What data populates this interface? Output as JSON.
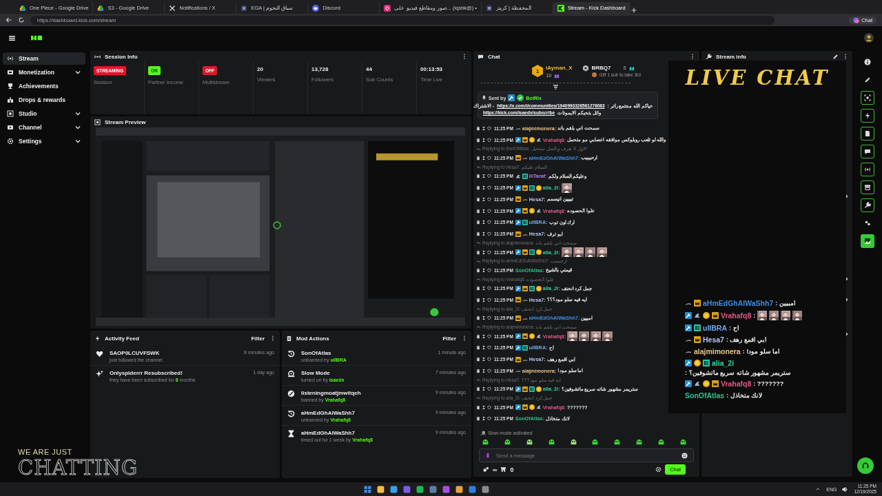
{
  "browser": {
    "tabs": [
      {
        "label": "One Piece - Google Drive",
        "kind": "drive",
        "selected": false
      },
      {
        "label": "S3 - Google Drive",
        "kind": "drive",
        "selected": false
      },
      {
        "label": "Notifications / X",
        "kind": "x",
        "selected": false
      },
      {
        "label": "EGA | سباق النجوم",
        "kind": "page",
        "selected": false
      },
      {
        "label": "Discord",
        "kind": "discord",
        "selected": false
      },
      {
        "label": "صور ومقاطع فيديو على... (iqsbk@) •",
        "kind": "camera",
        "selected": false
      },
      {
        "label": "المحفظة | كريتز",
        "kind": "page",
        "selected": false
      },
      {
        "label": "Stream - Kick Dashboard",
        "kind": "kick",
        "selected": true
      }
    ],
    "url": "https://dashboard.kick.com/stream",
    "chat_button": "Chat"
  },
  "sidebar": {
    "items": [
      {
        "label": "Stream",
        "kind": "stream",
        "selected": true,
        "expandable": false
      },
      {
        "label": "Monetization",
        "kind": "money",
        "selected": false,
        "expandable": true
      },
      {
        "label": "Achievements",
        "kind": "trophy",
        "selected": false,
        "expandable": false
      },
      {
        "label": "Drops & rewards",
        "kind": "gift",
        "selected": false,
        "expandable": false
      },
      {
        "label": "Studio",
        "kind": "studio",
        "selected": false,
        "expandable": true
      },
      {
        "label": "Channel",
        "kind": "channel",
        "selected": false,
        "expandable": true
      },
      {
        "label": "Settings",
        "kind": "gear",
        "selected": false,
        "expandable": true
      }
    ]
  },
  "overlay_art": {
    "tagline": "WE ARE JUST",
    "title": "CHATTING"
  },
  "session_info": {
    "title": "Session Info",
    "stats": [
      {
        "kind": "badge",
        "value": "STREAMING",
        "color": "#e3152b",
        "label": "Session"
      },
      {
        "kind": "badge",
        "value": "ON",
        "color": "#53fc18",
        "label": "Partner Income"
      },
      {
        "kind": "badge",
        "value": "OFF",
        "color": "#e3152b",
        "label": "Multistream"
      },
      {
        "kind": "number",
        "value": "20",
        "label": "Viewers"
      },
      {
        "kind": "number",
        "value": "13,728",
        "label": "Followers"
      },
      {
        "kind": "number",
        "value": "44",
        "label": "Sub Counts"
      },
      {
        "kind": "number",
        "value": "00:13:53",
        "label": "Time Live"
      }
    ]
  },
  "stream_preview": {
    "title": "Stream Preview",
    "kind": "picture"
  },
  "activity_feed": {
    "title": "Activity Feed",
    "filter": "Filter",
    "items": [
      {
        "kind": "heart",
        "name": "SAOP0LCUVFSWK",
        "detail": "just followed the channel",
        "time": "8 minutes ago"
      },
      {
        "kind": "sparkle",
        "name": "Onlyspiderrr Resubscribed!",
        "detail": "they have been subscribed for",
        "highlight": "8",
        "suffix": "months",
        "time": "1 day ago"
      }
    ]
  },
  "mod_actions": {
    "title": "Mod Actions",
    "filter": "Filter",
    "items": [
      {
        "kind": "unban",
        "name": "SonOfAtlas",
        "detail": "unbanned by",
        "highlight": "uIIBRA",
        "time": "1 minute ago"
      },
      {
        "kind": "slow",
        "name": "Slow Mode",
        "detail": "turned on by",
        "highlight": "isaedx",
        "time": "7 minutes ago"
      },
      {
        "kind": "ban",
        "name": "listeningmoatjmwitqeh",
        "detail": "banned by",
        "highlight": "Vrahafq8",
        "time": "9 minutes ago"
      },
      {
        "kind": "unban",
        "name": "aHmEdGhAlWaShh7",
        "detail": "unbanned by",
        "highlight": "Vrahafq8",
        "time": "9 minutes ago"
      },
      {
        "kind": "timeout",
        "name": "aHmEdGhAlWaShh7",
        "detail": "timed out for 1 week by",
        "highlight": "Vrahafq8",
        "time": "9 minutes ago"
      }
    ]
  },
  "chat": {
    "title": "Chat",
    "leaders": [
      {
        "rank": "1",
        "name": "iAyman_X",
        "count": "10"
      },
      {
        "name": "BRBQ7",
        "count": "5",
        "note": "Gift 1 sub to take 3rd"
      }
    ],
    "pinned": {
      "label": "Sent by",
      "badges": [
        {
          "kind": "mod"
        },
        {
          "kind": "verified"
        }
      ],
      "author": "BotRix",
      "lines": [
        [
          {
            "kind": "text",
            "text": "حياكم الله مجتمع راتر :"
          },
          {
            "kind": "link",
            "text": "https://x.com/i/communities/1940993326561276083"
          },
          {
            "kind": "text",
            "text": "- الاشتراك"
          }
        ],
        [
          {
            "kind": "link",
            "text": "https://kick.com/isaedx/subscribe"
          },
          {
            "kind": "text",
            "text": "واتل بتحبكم الايموتات"
          }
        ]
      ]
    },
    "messages": [
      {
        "time": "11:25 PM",
        "badges": [
          {
            "kind": "swoosh"
          }
        ],
        "user": "alajmimonera:",
        "color": "#e8c38b",
        "text": "سمحت اني بلقم باند"
      },
      {
        "time": "11:25 PM",
        "badges": [
          {
            "kind": "mod"
          },
          {
            "kind": "crown"
          },
          {
            "kind": "coin"
          },
          {
            "kind": "rider"
          }
        ],
        "user": "Vrahafq8:",
        "color": "#e0588a",
        "text": "والله لو تلعب روبلوكس موافقه اعصابي مو متحمل"
      },
      {
        "reply": "Replying to SonOfAtlas: الاول لا تعرف و السل ستحيل",
        "time": "11:25 PM",
        "badges": [
          {
            "kind": "crown"
          },
          {
            "kind": "swoosh"
          }
        ],
        "user": "aHmEdGhAlWaShh7:",
        "color": "#3e8ce0",
        "text": "ارحببببب"
      },
      {
        "reply": "Replying to Hesa7: السلام عليكم",
        "time": "11:25 PM",
        "badges": [
          {
            "kind": "rider"
          },
          {
            "kind": "sub"
          }
        ],
        "user": "iiiTaraf:",
        "color": "#b77ee6",
        "text": "وعليكم السلام ولكم"
      },
      {
        "time": "11:25 PM",
        "badges": [
          {
            "kind": "mod"
          },
          {
            "kind": "crown"
          },
          {
            "kind": "sub"
          },
          {
            "kind": "coin"
          }
        ],
        "user": "alia_2i:",
        "color": "#35d4a0",
        "emotes": [
          {
            "kind": "picture"
          }
        ]
      },
      {
        "time": "11:25 PM",
        "badges": [
          {
            "kind": "crown"
          },
          {
            "kind": "swoosh"
          }
        ],
        "user": "Hesa7:",
        "color": "#b8c4ef",
        "text": "تبييين انيسمم"
      },
      {
        "time": "11:25 PM",
        "badges": [
          {
            "kind": "mod"
          },
          {
            "kind": "crown"
          },
          {
            "kind": "coin"
          },
          {
            "kind": "rider"
          }
        ],
        "user": "Vrahafq8:",
        "color": "#e0588a",
        "text": "علوا الحصوده"
      },
      {
        "time": "11:25 PM",
        "badges": [
          {
            "kind": "mod"
          },
          {
            "kind": "sub"
          }
        ],
        "user": "uIIBRA:",
        "color": "#6fa6e8",
        "text": "ارك اون توب"
      },
      {
        "time": "11:25 PM",
        "badges": [
          {
            "kind": "crown"
          },
          {
            "kind": "swoosh"
          }
        ],
        "user": "Hesa7:",
        "color": "#b8c4ef",
        "text": "ابو ترف"
      },
      {
        "reply": "Replying to alajmimonera: سمحت اني بلقم باند",
        "time": "11:25 PM",
        "badges": [
          {
            "kind": "mod"
          },
          {
            "kind": "crown"
          },
          {
            "kind": "sub"
          },
          {
            "kind": "coin"
          }
        ],
        "user": "alia_2i:",
        "color": "#35d4a0",
        "emotes": [
          {
            "kind": "picture"
          },
          {
            "kind": "picture"
          },
          {
            "kind": "picture"
          },
          {
            "kind": "picture"
          }
        ]
      },
      {
        "reply": "Replying to aHmEdGhAlWaShh7: ارحببببب",
        "time": "11:25 PM",
        "user": "SonOfAtlas:",
        "color": "#2ec28a",
        "text": "قيمتي بالشيخ"
      },
      {
        "reply": "Replying to Vrahafq8: علوا الحصوده",
        "time": "11:25 PM",
        "badges": [
          {
            "kind": "mod"
          },
          {
            "kind": "crown"
          },
          {
            "kind": "sub"
          },
          {
            "kind": "coin"
          }
        ],
        "user": "alia_2i:",
        "color": "#35d4a0",
        "text": "جمل كرد انحنف"
      },
      {
        "time": "11:25 PM",
        "badges": [
          {
            "kind": "crown"
          },
          {
            "kind": "swoosh"
          }
        ],
        "user": "Hesa7:",
        "color": "#b8c4ef",
        "text": "ايه فيه سلو مود؟؟؟"
      },
      {
        "reply": "Replying to alia_2i: جمل كرد انحنف",
        "time": "11:25 PM",
        "badges": [
          {
            "kind": "crown"
          },
          {
            "kind": "swoosh"
          }
        ],
        "user": "aHmEdGhAlWaShh7:",
        "color": "#3e8ce0",
        "text": "امبيين"
      },
      {
        "reply": "Replying to alajmimonera: سمحت اني بلقم باند",
        "time": "11:25 PM",
        "badges": [
          {
            "kind": "mod"
          },
          {
            "kind": "crown"
          },
          {
            "kind": "coin"
          },
          {
            "kind": "rider"
          }
        ],
        "user": "Vrahafq8:",
        "color": "#e0588a",
        "emotes": [
          {
            "kind": "picture"
          },
          {
            "kind": "picture"
          },
          {
            "kind": "picture"
          },
          {
            "kind": "picture"
          }
        ]
      },
      {
        "time": "11:25 PM",
        "badges": [
          {
            "kind": "mod"
          },
          {
            "kind": "sub"
          }
        ],
        "user": "uIIBRA:",
        "color": "#6fa6e8",
        "text": "اح"
      },
      {
        "time": "11:25 PM",
        "badges": [
          {
            "kind": "crown"
          },
          {
            "kind": "swoosh"
          }
        ],
        "user": "Hesa7:",
        "color": "#b8c4ef",
        "text": "ابي اقمع رهف"
      },
      {
        "time": "11:25 PM",
        "badges": [
          {
            "kind": "swoosh"
          }
        ],
        "user": "alajmimonera:",
        "color": "#e8c38b",
        "text": "!اما سلو مود"
      },
      {
        "reply": "Replying to Hesa7: ايه فيه سلو مود؟؟؟",
        "time": "11:25 PM",
        "badges": [
          {
            "kind": "mod"
          },
          {
            "kind": "crown"
          },
          {
            "kind": "sub"
          },
          {
            "kind": "coin"
          }
        ],
        "user": "alia_2i:",
        "color": "#35d4a0",
        "text": "ستريمر مشهور شاته سريع ماتشوفين؟"
      },
      {
        "reply": "Replying to alia_2i: جمل كرد انحنف",
        "time": "11:25 PM",
        "badges": [
          {
            "kind": "mod"
          },
          {
            "kind": "crown"
          },
          {
            "kind": "coin"
          },
          {
            "kind": "rider"
          }
        ],
        "user": "Vrahafq8:",
        "color": "#e0588a",
        "text": "???????"
      },
      {
        "time": "11:25 PM",
        "user": "SonOfAtlas:",
        "color": "#2ec28a",
        "text": "لانك متخاذل"
      }
    ],
    "status": "Slow mode activated",
    "input": {
      "placeholder": "Send a message"
    },
    "infinity": "∞",
    "store_count": "0",
    "send_button": "Chat"
  },
  "stream_info": {
    "title": "Stream info"
  },
  "live_chat_overlay": {
    "title": "LIVE CHAT",
    "messages": [
      {
        "badges": [
          {
            "kind": "swoosh"
          },
          {
            "kind": "crown"
          }
        ],
        "user": "aHmEdGhAlWaShh7",
        "color": "#3e8ce0",
        "text": ": امبيين"
      },
      {
        "badges": [
          {
            "kind": "mod"
          },
          {
            "kind": "rider"
          },
          {
            "kind": "coin"
          },
          {
            "kind": "crown"
          }
        ],
        "user": "Vrahafq8",
        "color": "#e0588a",
        "text": ":",
        "emotes": [
          {
            "kind": "picture"
          },
          {
            "kind": "picture"
          },
          {
            "kind": "picture"
          },
          {
            "kind": "picture"
          }
        ]
      },
      {
        "badges": [
          {
            "kind": "mod"
          },
          {
            "kind": "sub"
          }
        ],
        "user": "uIIBRA",
        "color": "#6fa6e8",
        "text": ": اح"
      },
      {
        "badges": [
          {
            "kind": "swoosh"
          },
          {
            "kind": "crown"
          }
        ],
        "user": "Hesa7",
        "color": "#b8c4ef",
        "text": ": ابي اقمع رهف"
      },
      {
        "badges": [
          {
            "kind": "swoosh"
          }
        ],
        "user": "alajmimonera",
        "color": "#e8c38b",
        "text": ": !اما سلو مود"
      },
      {
        "badges": [
          {
            "kind": "mod"
          },
          {
            "kind": "coin"
          },
          {
            "kind": "sub"
          }
        ],
        "user": "alia_2i",
        "color": "#35d4a0",
        "text": ": ستريمر مشهور شاته سريع ماتشوفين؟"
      },
      {
        "badges": [
          {
            "kind": "mod"
          },
          {
            "kind": "rider"
          },
          {
            "kind": "coin"
          },
          {
            "kind": "crown"
          }
        ],
        "user": "Vrahafq8",
        "color": "#e0588a",
        "text": ": ???????"
      },
      {
        "user": "SonOfAtlas",
        "color": "#2ec28a",
        "text": ": لانك متخاذل"
      }
    ]
  },
  "taskbar": {
    "language": "ENG",
    "time": "11:25 PM",
    "date": "12/19/2025"
  }
}
